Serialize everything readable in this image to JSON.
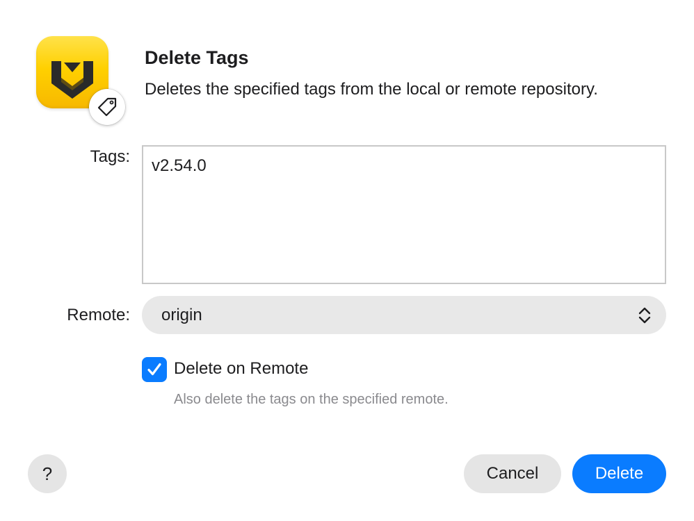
{
  "dialog": {
    "title": "Delete Tags",
    "subtitle": "Deletes the specified tags from the local or remote repository.",
    "app_icon": "app-logo-icon",
    "badge_icon": "tag-icon"
  },
  "form": {
    "tags_label": "Tags:",
    "tags_value": "v2.54.0",
    "remote_label": "Remote:",
    "remote_value": "origin",
    "remote_icon": "chevron-up-down-icon",
    "delete_on_remote": {
      "checked": true,
      "label": "Delete on Remote",
      "help": "Also delete the tags on the specified remote."
    }
  },
  "buttons": {
    "help_label": "?",
    "cancel_label": "Cancel",
    "delete_label": "Delete"
  },
  "colors": {
    "accent": "#0a7cff",
    "app_icon_yellow": "#ffd000",
    "button_gray": "#e5e5e5",
    "help_text": "#8a8a8e"
  }
}
